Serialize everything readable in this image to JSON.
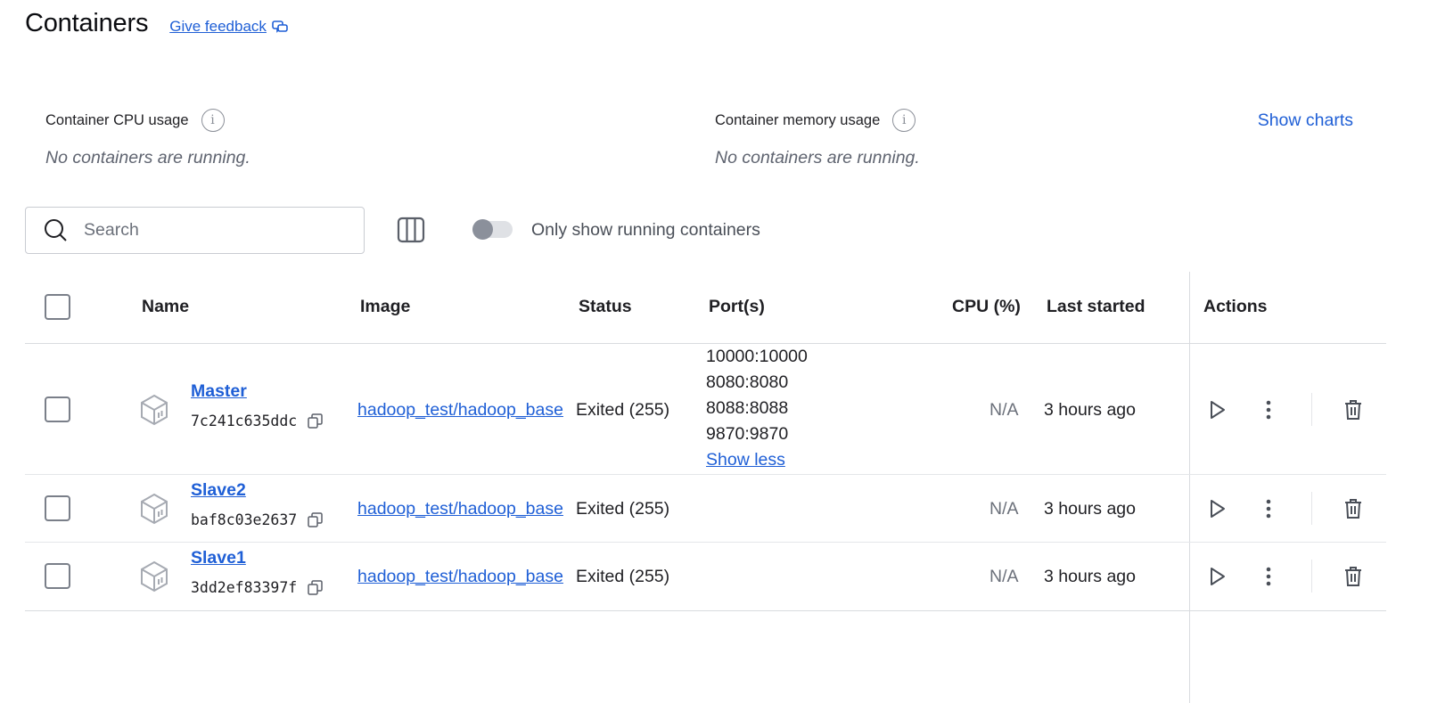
{
  "header": {
    "title": "Containers",
    "feedback_label": "Give feedback"
  },
  "usage": {
    "cpu": {
      "title": "Container CPU usage",
      "message": "No containers are running."
    },
    "memory": {
      "title": "Container memory usage",
      "message": "No containers are running."
    },
    "show_charts_label": "Show charts"
  },
  "toolbar": {
    "search_placeholder": "Search",
    "toggle_label": "Only show running containers",
    "toggle_on": false
  },
  "table": {
    "columns": {
      "name": "Name",
      "image": "Image",
      "status": "Status",
      "ports": "Port(s)",
      "cpu": "CPU (%)",
      "last_started": "Last started",
      "actions": "Actions"
    },
    "rows": [
      {
        "name": "Master",
        "id": "7c241c635ddc",
        "image": "hadoop_test/hadoop_base",
        "status": "Exited (255)",
        "ports": [
          "10000:10000",
          "8080:8080",
          "8088:8088",
          "9870:9870"
        ],
        "ports_toggle_label": "Show less",
        "cpu": "N/A",
        "last_started": "3 hours ago"
      },
      {
        "name": "Slave2",
        "id": "baf8c03e2637",
        "image": "hadoop_test/hadoop_base",
        "status": "Exited (255)",
        "ports": [],
        "cpu": "N/A",
        "last_started": "3 hours ago"
      },
      {
        "name": "Slave1",
        "id": "3dd2ef83397f",
        "image": "hadoop_test/hadoop_base",
        "status": "Exited (255)",
        "ports": [],
        "cpu": "N/A",
        "last_started": "3 hours ago"
      }
    ]
  },
  "colors": {
    "link": "#1f5fd6",
    "muted": "#6b707a",
    "border": "#d9dbdf"
  },
  "icons": {
    "feedback": "chat-bubbles-icon",
    "info": "info-icon",
    "search": "search-icon",
    "columns": "columns-icon",
    "container": "cube-icon",
    "copy": "copy-icon",
    "start": "play-icon",
    "more": "more-vertical-icon",
    "delete": "trash-icon"
  }
}
